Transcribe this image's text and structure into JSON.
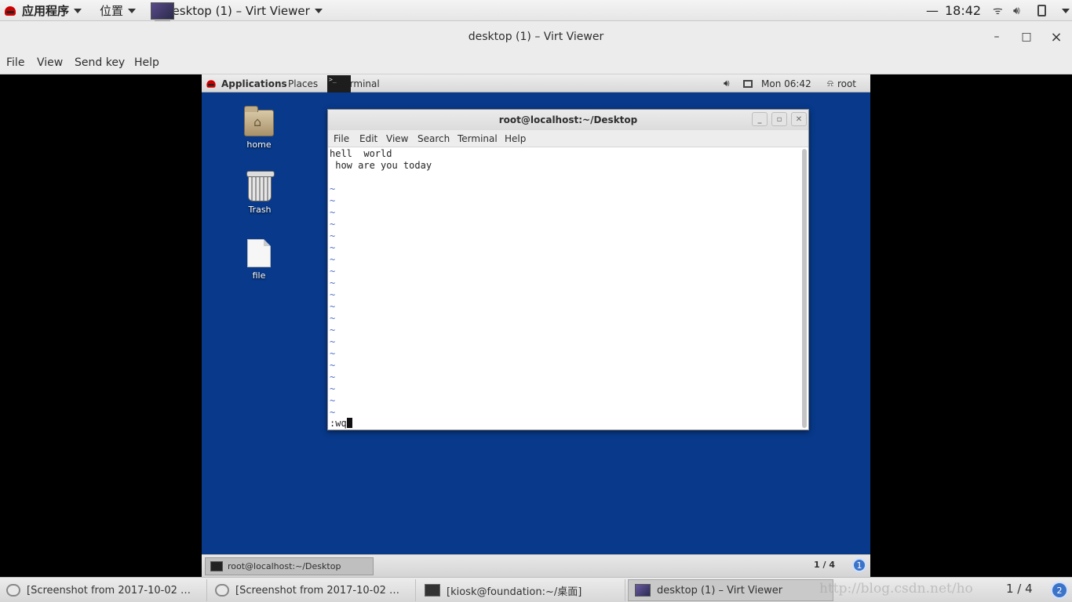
{
  "host_topbar": {
    "applications": "应用程序",
    "places": "位置",
    "active_app": "desktop (1) – Virt Viewer",
    "clock": "18:42"
  },
  "window": {
    "title": "desktop (1) – Virt Viewer",
    "minimize": "–",
    "maximize": "□",
    "close": "×"
  },
  "menubar": [
    "File",
    "View",
    "Send key",
    "Help"
  ],
  "guest": {
    "topbar": {
      "applications": "Applications",
      "places": "Places",
      "terminal": "Terminal",
      "clock": "Mon 06:42",
      "user": "root"
    },
    "desktop_icons": [
      "home",
      "Trash",
      "file"
    ],
    "terminal": {
      "title": "root@localhost:~/Desktop",
      "menu": [
        "File",
        "Edit",
        "View",
        "Search",
        "Terminal",
        "Help"
      ],
      "lines": [
        "hell  world",
        " how are you today"
      ],
      "tilde": "~",
      "command": ":wq"
    },
    "taskbar": {
      "task": "root@localhost:~/Desktop",
      "workspace": "1 / 4",
      "badge": "1"
    }
  },
  "host_taskbar": {
    "tasks": [
      "[Screenshot from 2017-10-02 …",
      "[Screenshot from 2017-10-02 …",
      "[kiosk@foundation:~/桌面]",
      "desktop (1) – Virt Viewer"
    ],
    "watermark": "http://blog.csdn.net/ho",
    "workspace": "1 / 4",
    "badge": "2"
  }
}
